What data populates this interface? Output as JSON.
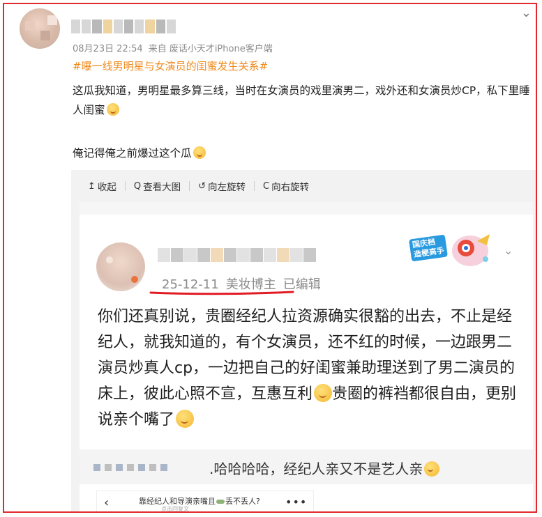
{
  "post": {
    "meta": {
      "datetime": "08月23日 22:54",
      "source": "来自 废话小天才iPhone客户端"
    },
    "hashtag": "#曝一线男明星与女演员的闺蜜发生关系#",
    "paragraph1": "这瓜我知道，男明星最多算三线，当时在女演员的戏里演男二，戏外还和女演员炒CP，私下里睡人闺蜜",
    "paragraph2": "俺记得俺之前爆过这个瓜"
  },
  "viewer": {
    "toolbar": {
      "collapse": "收起",
      "view_large": "查看大图",
      "rotate_left": "向左旋转",
      "rotate_right": "向右旋转"
    },
    "screenshot": {
      "meta": {
        "date": "25-12-11",
        "tag": "美妆博主",
        "edited": "已编辑"
      },
      "badge": "国庆档\n造梗高手",
      "body": "你们还真别说，贵圈经纪人拉资源确实很豁的出去，不止是经纪人，就我知道的，有个女演员，还不红的时候，一边跟男二演员炒真人cp，一边把自己的好闺蜜兼助理送到了男二演员的床上，彼此心照不宣，互惠互利",
      "body_tail": "贵圈的裤裆都很自由，更别说亲个嘴了",
      "reply": ".哈哈哈哈，经纪人亲又不是艺人亲",
      "nav": {
        "title": "靠经纪人和导演亲嘴且",
        "title_tail": "丢不丢人?",
        "sub": "点击回复文"
      }
    }
  },
  "colors": {
    "frame": "#e2282c",
    "hashtag": "#f08a1c",
    "underline": "#e01b24"
  }
}
